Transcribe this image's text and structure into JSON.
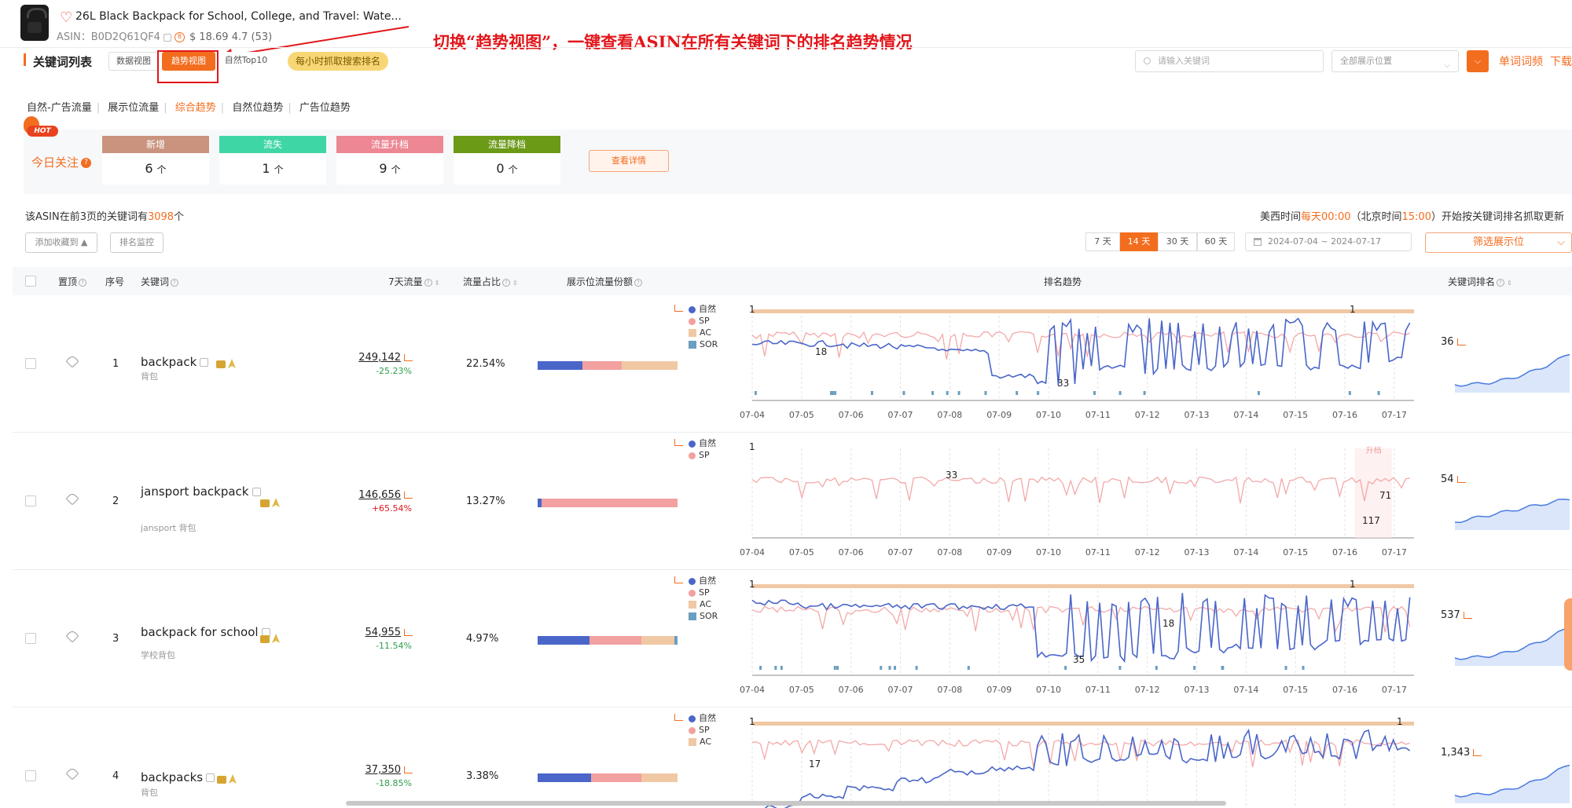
{
  "product": {
    "title": "26L Black Backpack for School, College, and Travel: Wate...",
    "asin_label": "ASIN：",
    "asin": "B0D2Q61QF4",
    "badge": "8",
    "price_rating": "$ 18.69 4.7 (53)"
  },
  "annotation": "切换“趋势视图”，一键查看ASIN在所有关键词下的排名趋势情况",
  "toolbar": {
    "title": "关键词列表",
    "data_view": "数据视图",
    "trend_view": "趋势视图",
    "organic_top10": "自然Top10",
    "hourly": "每小时抓取搜索排名",
    "search_placeholder": "请输入关键词",
    "position_select": "全部展示位置",
    "single_kw_freq": "单词词频",
    "download": "下载"
  },
  "sub_tabs": [
    "自然-广告流量",
    "展示位流量",
    "综合趋势",
    "自然位趋势",
    "广告位趋势"
  ],
  "sub_tab_active": 2,
  "today": {
    "hot": "HOT",
    "label": "今日关注",
    "cards": [
      {
        "title": "新增",
        "value": "6",
        "unit": "个",
        "color": "#c9937e"
      },
      {
        "title": "流失",
        "value": "1",
        "unit": "个",
        "color": "#3fd6a6"
      },
      {
        "title": "流量升档",
        "value": "9",
        "unit": "个",
        "color": "#ec8793"
      },
      {
        "title": "流量降档",
        "value": "0",
        "unit": "个",
        "color": "#6b9a17"
      }
    ],
    "detail_button": "查看详情"
  },
  "summary": {
    "prefix": "该ASIN在前3页的关键词有",
    "count": "3098",
    "suffix": "个",
    "time_a": "美西时间",
    "time_b": "每天00:00",
    "time_c": "（北京时间",
    "time_d": "15:00",
    "time_e": "）开始按关键词排名抓取更新"
  },
  "actions": {
    "add_fav": "添加收藏到 ▲",
    "rank_monitor": "排名监控",
    "days": [
      "7 天",
      "14 天",
      "30 天",
      "60 天"
    ],
    "days_active": 1,
    "date_from": "2024-07-04",
    "date_sep": "~",
    "date_to": "2024-07-17",
    "filter_positions": "筛选展示位"
  },
  "columns": {
    "pin": "置顶",
    "index": "序号",
    "keyword": "关键词",
    "flow7": "7天流量",
    "flow_share": "流量占比",
    "position_share": "展示位流量份额",
    "rank_trend": "排名趋势",
    "kw_rank": "关键词排名"
  },
  "x_ticks": [
    "07-04",
    "07-05",
    "07-06",
    "07-07",
    "07-08",
    "07-09",
    "07-10",
    "07-11",
    "07-12",
    "07-13",
    "07-14",
    "07-15",
    "07-16",
    "07-17"
  ],
  "colors": {
    "organic": "#4a66c9",
    "sp": "#f2a0a0",
    "ac": "#f0c8a4",
    "sor": "#6b9ec0",
    "accent": "#f36d1e"
  },
  "rows": [
    {
      "index": "1",
      "keyword": "backpack",
      "translation": "背包",
      "flow": "249,142",
      "change": "-25.23%",
      "dir": "down",
      "share": "22.54%",
      "bar": [
        0.32,
        0.28,
        0.4
      ],
      "legend": [
        "自然",
        "SP",
        "AC",
        "SOR"
      ],
      "labels": [
        "1",
        "18",
        "33",
        "1"
      ],
      "rank": "36"
    },
    {
      "index": "2",
      "keyword": "jansport backpack",
      "translation": "jansport 背包",
      "flow": "146,656",
      "change": "+65.54%",
      "dir": "up",
      "share": "13.27%",
      "bar": [
        0.03,
        0.97,
        0.0
      ],
      "legend": [
        "自然",
        "SP"
      ],
      "labels": [
        "1",
        "33",
        "71",
        "117"
      ],
      "highlight": "升档",
      "rank": "54"
    },
    {
      "index": "3",
      "keyword": "backpack for school",
      "translation": "学校背包",
      "flow": "54,955",
      "change": "-11.54%",
      "dir": "down",
      "share": "4.97%",
      "bar": [
        0.37,
        0.37,
        0.24,
        0.02
      ],
      "legend": [
        "自然",
        "SP",
        "AC",
        "SOR"
      ],
      "labels": [
        "1",
        "18",
        "35",
        "1"
      ],
      "rank": "537"
    },
    {
      "index": "4",
      "keyword": "backpacks",
      "translation": "背包",
      "flow": "37,350",
      "change": "-18.85%",
      "dir": "down",
      "share": "3.38%",
      "bar": [
        0.38,
        0.36,
        0.26
      ],
      "legend": [
        "自然",
        "SP",
        "AC"
      ],
      "labels": [
        "1",
        "17",
        "1"
      ],
      "rank": "1,343"
    }
  ]
}
